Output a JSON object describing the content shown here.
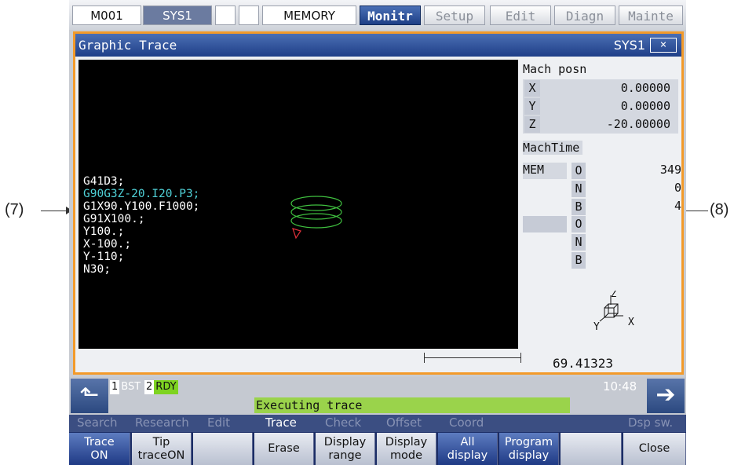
{
  "callouts": {
    "left": "(7)",
    "right": "(8)"
  },
  "top_tabs": {
    "status": [
      "M001",
      "SYS1",
      "",
      "",
      "MEMORY"
    ],
    "menus": [
      "Monitr",
      "Setup",
      "Edit",
      "Diagn",
      "Mainte"
    ],
    "active": "Monitr"
  },
  "window": {
    "title": "Graphic Trace",
    "system": "SYS1",
    "close_label": "×"
  },
  "program_lines": [
    "G41D3;",
    "G90G3Z-20.I20.P3;",
    "G1X90.Y100.F1000;",
    "G91X100.;",
    "Y100.;",
    "X-100.;",
    "Y-110;",
    "N30;"
  ],
  "current_line_index": 1,
  "colors": {
    "trace_path": "#3fbf3f",
    "tool_marker": "#e0303a",
    "current_line": "#4fd0d6",
    "window_border": "#f39a2a",
    "message_bg": "#9ad34b"
  },
  "mach_posn": {
    "label": "Mach posn",
    "axes": [
      {
        "axis": "X",
        "value": "0.00000"
      },
      {
        "axis": "Y",
        "value": "0.00000"
      },
      {
        "axis": "Z",
        "value": "-20.00000"
      }
    ]
  },
  "mach_time": {
    "label": "MachTime",
    "mode": "MEM",
    "rows": [
      {
        "key": "O",
        "value": "349"
      },
      {
        "key": "N",
        "value": "0"
      },
      {
        "key": "B",
        "value": "4"
      },
      {
        "key": "O",
        "value": ""
      },
      {
        "key": "N",
        "value": ""
      },
      {
        "key": "B",
        "value": ""
      }
    ]
  },
  "axis_icon": {
    "z": "Z",
    "y": "Y",
    "x": "X"
  },
  "scale_distance": "69.41323",
  "status_bar": {
    "chips": [
      {
        "num": "1",
        "text": "BST"
      },
      {
        "num": "2",
        "text": "RDY"
      }
    ],
    "message": "Executing trace",
    "time": "10:48",
    "prev_icon": "up-arrow-icon",
    "next_icon": "right-arrow-icon"
  },
  "upper_menu": [
    "Search",
    "Research",
    "Edit",
    "Trace",
    "Check",
    "Offset",
    "Coord",
    "Dsp sw."
  ],
  "upper_menu_active": "Trace",
  "softkeys": [
    {
      "line1": "Trace",
      "line2": "ON",
      "on": true
    },
    {
      "line1": "Tip",
      "line2": "traceON",
      "on": false
    },
    {
      "line1": "",
      "line2": "",
      "on": false
    },
    {
      "line1": "Erase",
      "line2": "",
      "on": false
    },
    {
      "line1": "Display",
      "line2": "range",
      "on": false
    },
    {
      "line1": "Display",
      "line2": "mode",
      "on": false
    },
    {
      "line1": "All",
      "line2": "display",
      "on": true
    },
    {
      "line1": "Program",
      "line2": "display",
      "on": true
    },
    {
      "line1": "",
      "line2": "",
      "on": false
    },
    {
      "line1": "Close",
      "line2": "",
      "on": false
    }
  ]
}
